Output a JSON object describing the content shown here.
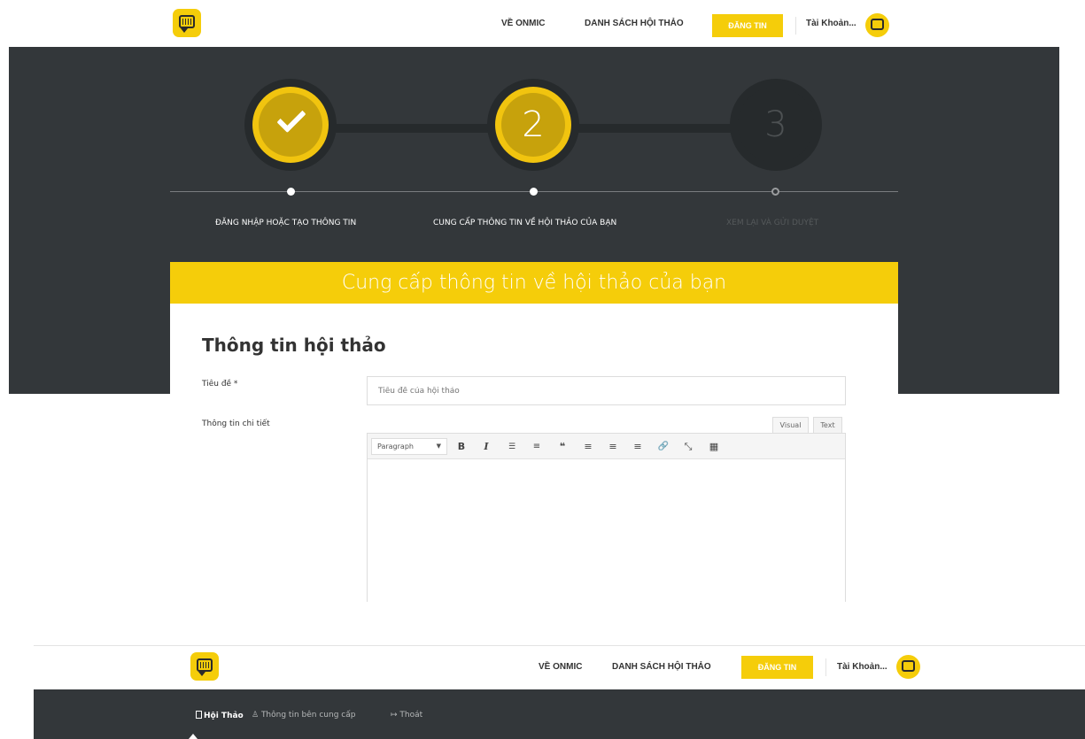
{
  "header": {
    "nav": [
      "VỀ ONMIC",
      "DANH SÁCH HỘI THẢO"
    ],
    "cta": "ĐĂNG TIN",
    "account": "Tài Khoản..."
  },
  "steps": {
    "items": [
      {
        "number": "",
        "label": "ĐĂNG NHẬP HOẶC TẠO THÔNG TIN",
        "status": "done"
      },
      {
        "number": "2",
        "label": "CUNG CẤP THÔNG TIN VỀ HỘI THẢO CỦA BẠN",
        "status": "active"
      },
      {
        "number": "3",
        "label": "XEM LẠI VÀ GỬI DUYỆT",
        "status": "pending"
      }
    ]
  },
  "card": {
    "heading": "Cung cấp thông tin về hội thảo của bạn",
    "section_title": "Thông tin hội thảo",
    "title_label": "Tiêu đề *",
    "title_placeholder": "Tiêu đề của hội thảo",
    "title_value": "",
    "details_label": "Thông tin chi tiết",
    "editor": {
      "tabs": [
        "Visual",
        "Text"
      ],
      "active_tab": "Visual",
      "format_select": "Paragraph",
      "buttons": [
        {
          "name": "bold-icon",
          "glyph": "B"
        },
        {
          "name": "italic-icon",
          "glyph": "I"
        },
        {
          "name": "bullet-list-icon",
          "glyph": "☰"
        },
        {
          "name": "numbered-list-icon",
          "glyph": "≡"
        },
        {
          "name": "blockquote-icon",
          "glyph": "❝"
        },
        {
          "name": "align-left-icon",
          "glyph": "≡"
        },
        {
          "name": "align-center-icon",
          "glyph": "≡"
        },
        {
          "name": "align-right-icon",
          "glyph": "≡"
        },
        {
          "name": "link-icon",
          "glyph": "🔗"
        },
        {
          "name": "fullscreen-icon",
          "glyph": "⤡"
        },
        {
          "name": "toolbar-toggle-icon",
          "glyph": "▦"
        }
      ]
    }
  },
  "bottom": {
    "header": {
      "nav": [
        "VỀ ONMIC",
        "DANH SÁCH HỘI THẢO"
      ],
      "cta": "ĐĂNG TIN",
      "account": "Tài Khoản..."
    },
    "subnav": [
      "Hội Thảo",
      "Thông tin bên cung cấp",
      "Thoát"
    ]
  },
  "colors": {
    "accent": "#f5cd0a",
    "dark": "#33373a",
    "step_ring": "#262a2c"
  }
}
